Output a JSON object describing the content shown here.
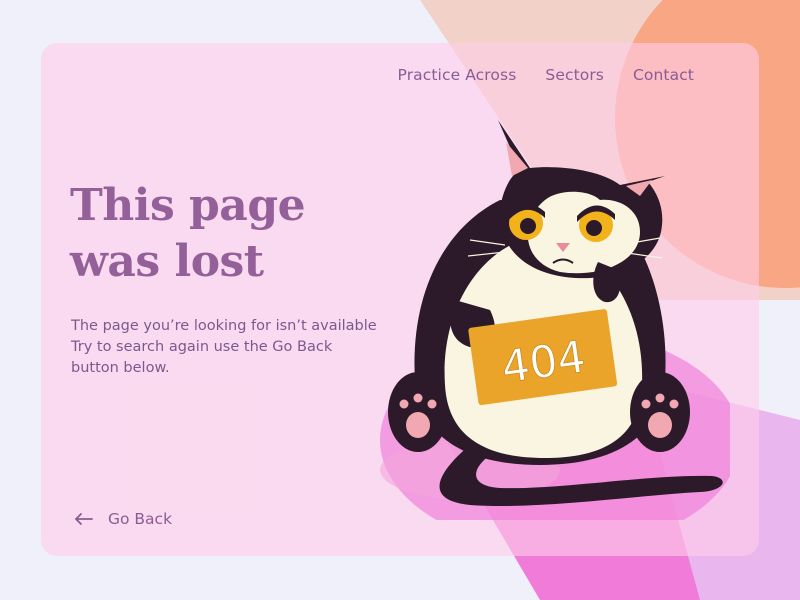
{
  "nav": {
    "items": [
      {
        "label": "Practice Across"
      },
      {
        "label": "Sectors"
      },
      {
        "label": "Contact"
      }
    ]
  },
  "hero": {
    "title_line1": "This page",
    "title_line2": "was lost",
    "description_line1": "The page you’re looking for isn’t available",
    "description_line2": "Try to search again use the Go Back",
    "description_line3": "button below."
  },
  "go_back": {
    "label": "Go Back",
    "icon": "arrow-left-icon"
  },
  "illustration": {
    "sign_text": "404"
  },
  "colors": {
    "background": "#f0f0fb",
    "card": "#fcd6ea",
    "accent_orange": "#f8a683",
    "accent_magenta": "#f47ad8",
    "text_primary": "#946099",
    "sign": "#eba42a"
  }
}
